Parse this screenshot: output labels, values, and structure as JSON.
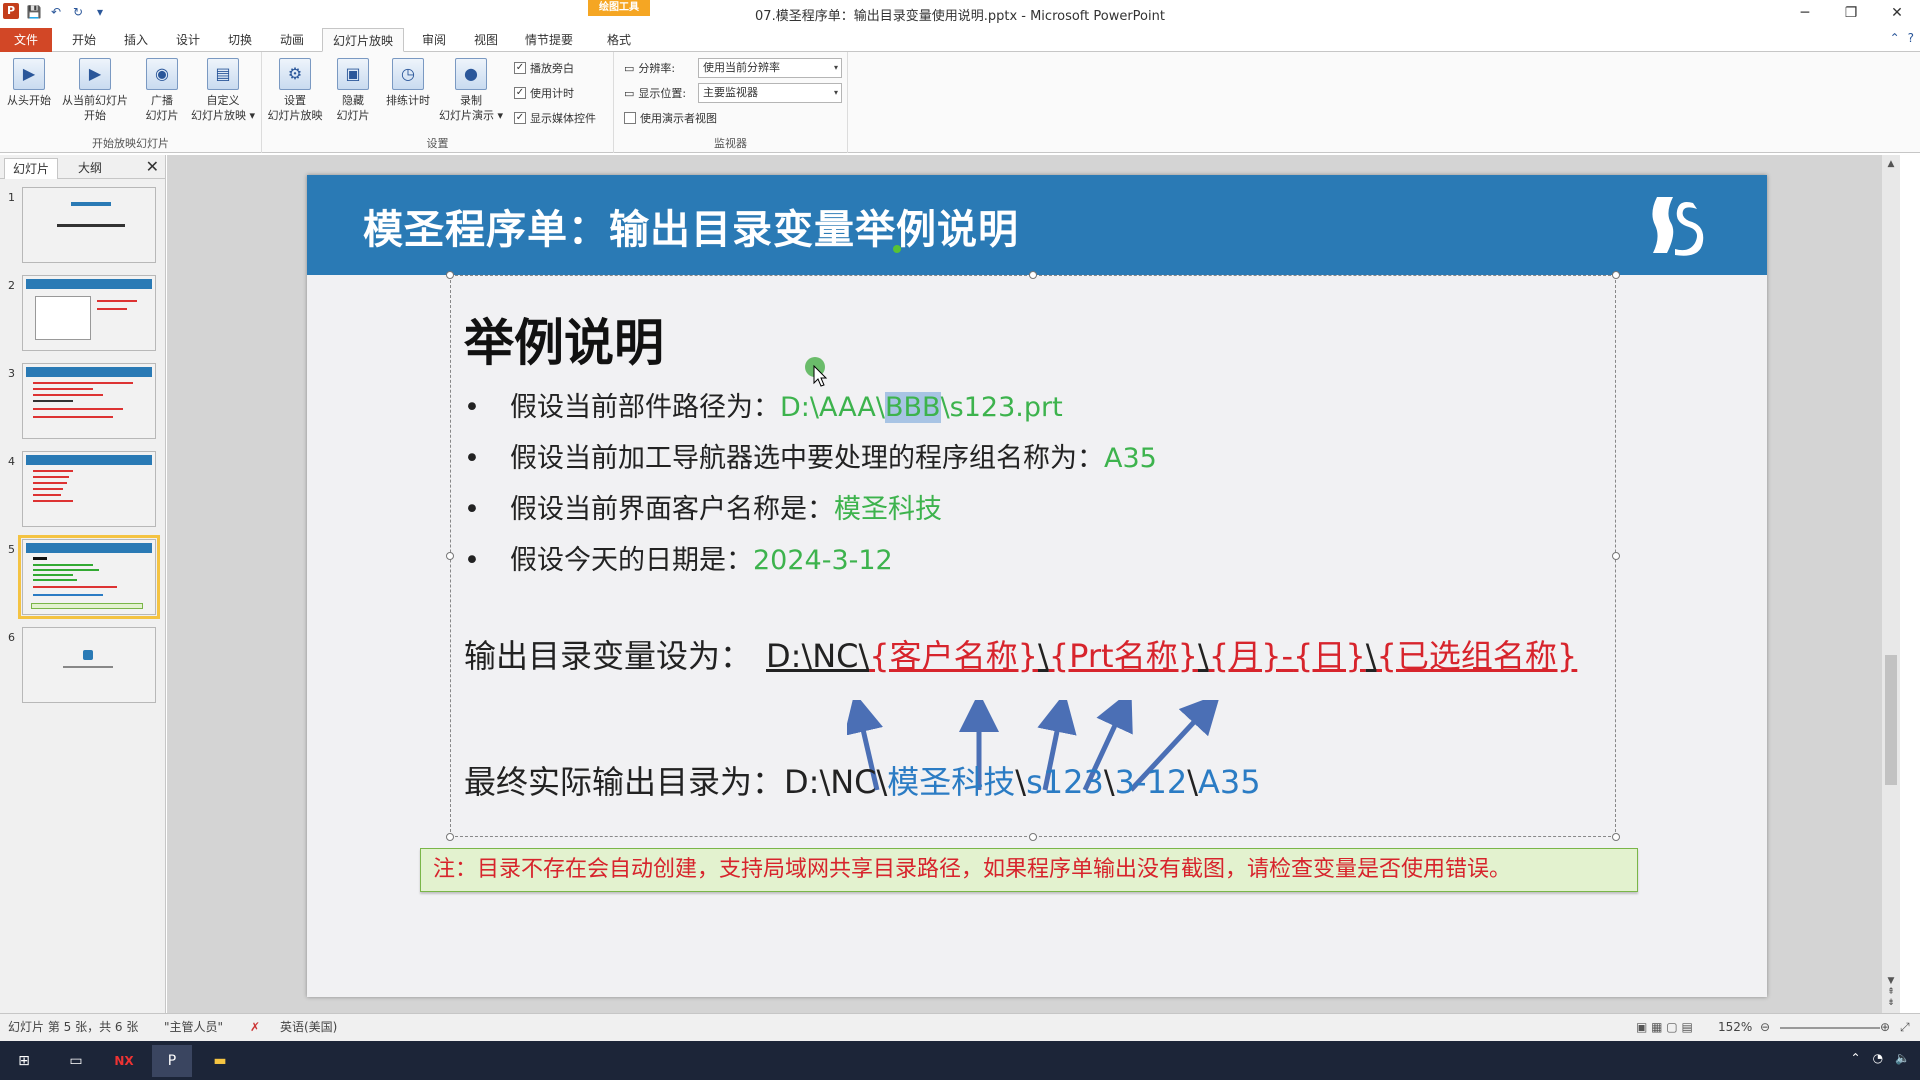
{
  "window": {
    "title": "07.模圣程序单：输出目录变量使用说明.pptx - Microsoft PowerPoint",
    "context_tab_group": "绘图工具",
    "controls": [
      "─",
      "❐",
      "✕"
    ]
  },
  "tabs": [
    "文件",
    "开始",
    "插入",
    "设计",
    "切换",
    "动画",
    "幻灯片放映",
    "审阅",
    "视图",
    "情节提要",
    "格式"
  ],
  "active_tab": "幻灯片放映",
  "ribbon": {
    "groups": {
      "start": {
        "label": "开始放映幻灯片",
        "buttons": [
          "从头开始",
          "从当前幻灯片\n开始",
          "广播\n幻灯片",
          "自定义\n幻灯片放映 ▾"
        ]
      },
      "setup": {
        "label": "设置",
        "buttons": [
          "设置\n幻灯片放映",
          "隐藏\n幻灯片",
          "排练计时",
          "录制\n幻灯片演示 ▾"
        ],
        "checkboxes": [
          {
            "label": "播放旁白",
            "checked": true
          },
          {
            "label": "使用计时",
            "checked": true
          },
          {
            "label": "显示媒体控件",
            "checked": true
          }
        ]
      },
      "monitor": {
        "label": "监视器",
        "resolution_label": "分辨率:",
        "resolution_value": "使用当前分辨率",
        "display_label": "显示位置:",
        "display_value": "主要监视器",
        "presenter_view": {
          "label": "使用演示者视图",
          "checked": false
        }
      }
    }
  },
  "panel": {
    "tabs": [
      "幻灯片",
      "大纲"
    ],
    "close": "✕",
    "slide_numbers": [
      "1",
      "2",
      "3",
      "4",
      "5",
      "6"
    ],
    "selected": 5
  },
  "slide": {
    "header_title": "模圣程序单：输出目录变量举例说明",
    "heading": "举例说明",
    "bullets": [
      {
        "label": "假设当前部件路径为：",
        "value_pre": "D:\\AAA\\",
        "value_sel": "BBB",
        "value_post": "\\s123.prt"
      },
      {
        "label": "假设当前加工导航器选中要处理的程序组名称为：",
        "value": "A35"
      },
      {
        "label": "假设当前界面客户名称是：",
        "value": "模圣科技"
      },
      {
        "label": "假设今天的日期是：",
        "value": "2024-3-12"
      }
    ],
    "variable_line": {
      "label": "输出目录变量设为：",
      "prefix": "D:\\NC\\",
      "var1": "{客户名称}",
      "sep1": "\\",
      "var2": "{Prt名称}",
      "sep2": "\\",
      "var3": "{月}",
      "dash": "-",
      "var4": "{日}",
      "sep3": "\\",
      "var5": "{已选组名称}"
    },
    "result_line": {
      "label": "最终实际输出目录为：",
      "prefix": "D:\\NC\\",
      "v1": "模圣科技",
      "s1": "\\",
      "v2": "s123",
      "s2": "\\",
      "v3": "3-12",
      "s3": "\\",
      "v4": "A35"
    },
    "note": "注：目录不存在会自动创建，支持局域网共享目录路径，如果程序单输出没有截图，请检查变量是否使用错误。"
  },
  "status": {
    "slide_info": "幻灯片 第 5 张，共 6 张",
    "theme": "\"主管人员\"",
    "language": "英语(美国)",
    "zoom": "152%"
  },
  "colors": {
    "header_blue": "#2a7ab5",
    "value_green": "#3db34d",
    "variable_red": "#d7242c",
    "result_blue": "#2b7cc4",
    "note_bg": "#e3f2cf"
  }
}
